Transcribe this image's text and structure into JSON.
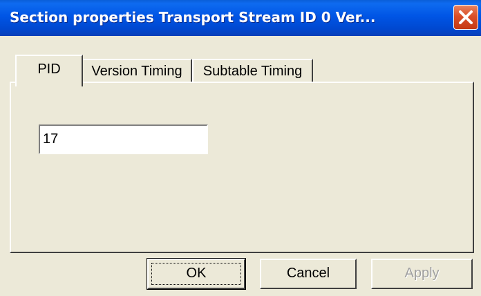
{
  "window": {
    "title": "Section properties Transport Stream ID    0 Ver...",
    "close_icon": "close-icon"
  },
  "tabs": [
    {
      "label": "PID",
      "active": true
    },
    {
      "label": "Version Timing",
      "active": false
    },
    {
      "label": "Subtable Timing",
      "active": false
    }
  ],
  "pid_panel": {
    "pid_value": "17"
  },
  "buttons": {
    "ok": "OK",
    "cancel": "Cancel",
    "apply": "Apply",
    "apply_enabled": false
  },
  "colors": {
    "titlebar": "#0055e5",
    "close_button": "#d94f28",
    "dialog_background": "#ece9d8",
    "disabled_text": "#a0a0a0"
  }
}
